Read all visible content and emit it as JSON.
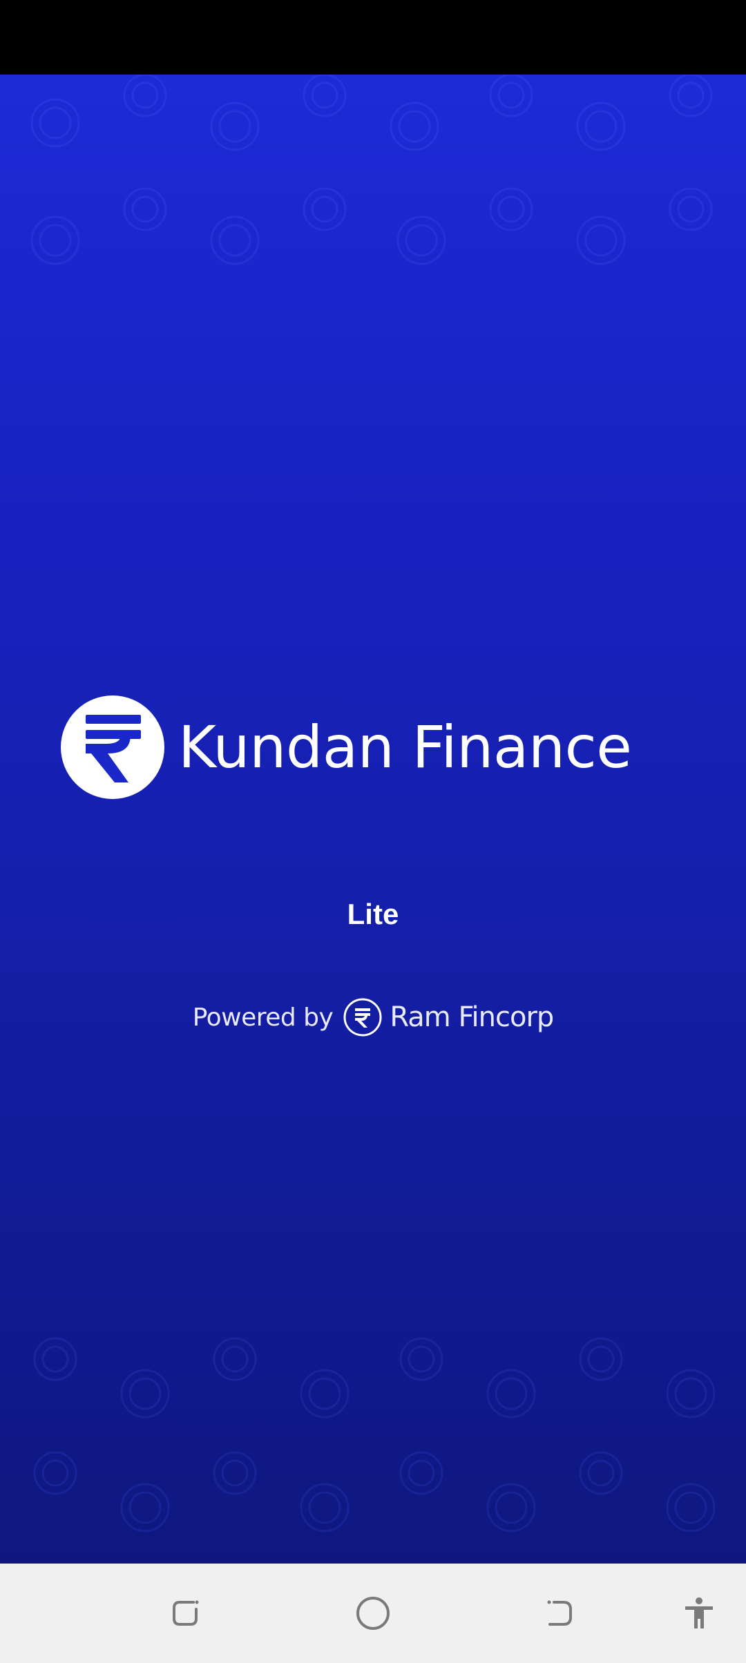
{
  "app": {
    "brand_name": "Kundan Finance",
    "variant": "Lite",
    "powered_by_prefix": "Powered by",
    "powered_by_company": "Ram Fincorp"
  },
  "colors": {
    "background_top": "#1d2bd6",
    "background_bottom": "#0f177f",
    "text": "#ffffff",
    "nav_bar": "#f0f0f0",
    "nav_icon": "#7a7a7a"
  },
  "navigation": {
    "buttons": [
      {
        "name": "recents-button",
        "icon": "recents-icon"
      },
      {
        "name": "home-button",
        "icon": "home-circle-icon"
      },
      {
        "name": "back-button",
        "icon": "back-icon"
      },
      {
        "name": "accessibility-button",
        "icon": "accessibility-icon"
      }
    ]
  }
}
